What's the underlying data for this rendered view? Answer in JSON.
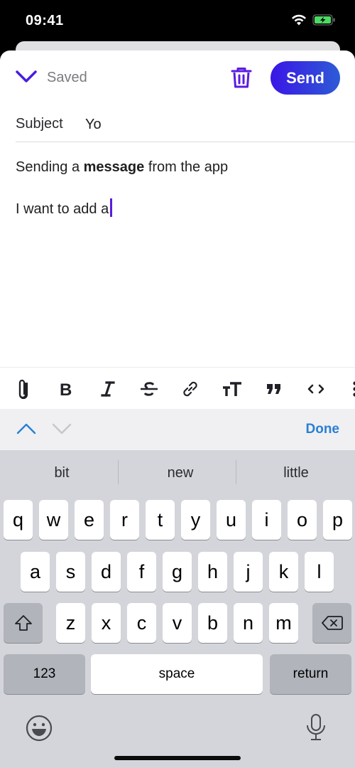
{
  "status_bar": {
    "time": "09:41",
    "icons": [
      "wifi-icon",
      "battery-charging-icon"
    ],
    "battery_color": "#4cd964"
  },
  "header": {
    "status_text": "Saved",
    "send_label": "Send",
    "accent_color": "#4a1de0",
    "icons": [
      "chevron-down-icon",
      "trash-icon"
    ]
  },
  "subject": {
    "label": "Subject",
    "value": "Yo"
  },
  "body": {
    "paragraphs": [
      {
        "segments": [
          {
            "text": "Sending a ",
            "bold": false
          },
          {
            "text": "message",
            "bold": true
          },
          {
            "text": " from the app",
            "bold": false
          }
        ]
      },
      {
        "segments": [
          {
            "text": "I want to add a",
            "bold": false
          }
        ]
      }
    ]
  },
  "format_toolbar": {
    "tools": [
      "attachment",
      "bold",
      "italic",
      "strikethrough",
      "link",
      "text-size",
      "quote",
      "code",
      "more"
    ]
  },
  "accessory": {
    "done_label": "Done",
    "icons": [
      "chevron-up-icon",
      "chevron-down-icon"
    ]
  },
  "keyboard": {
    "suggestions": [
      "bit",
      "new",
      "little"
    ],
    "rows": [
      [
        "q",
        "w",
        "e",
        "r",
        "t",
        "y",
        "u",
        "i",
        "o",
        "p"
      ],
      [
        "a",
        "s",
        "d",
        "f",
        "g",
        "h",
        "j",
        "k",
        "l"
      ],
      [
        "z",
        "x",
        "c",
        "v",
        "b",
        "n",
        "m"
      ]
    ],
    "numbers_label": "123",
    "space_label": "space",
    "return_label": "return",
    "icons": [
      "shift-icon",
      "backspace-icon",
      "emoji-icon",
      "microphone-icon"
    ]
  }
}
